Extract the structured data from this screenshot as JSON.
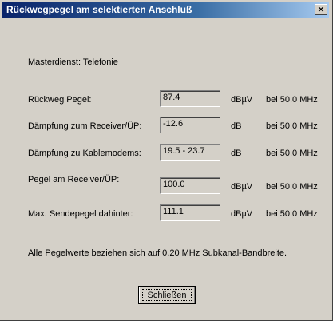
{
  "window": {
    "title": "Rückwegpegel am selektierten Anschluß",
    "close_glyph": "×"
  },
  "master_service": "Masterdienst: Telefonie",
  "rows": [
    {
      "label": "Rückweg Pegel:",
      "value": "87.4",
      "unit": "dBµV",
      "freq": "bei 50.0 MHz"
    },
    {
      "label": "Dämpfung zum Receiver/ÜP:",
      "value": "-12.6",
      "unit": "dB",
      "freq": "bei 50.0 MHz"
    },
    {
      "label": "Dämpfung zu Kablemodems:",
      "value": "19.5 - 23.7",
      "unit": "dB",
      "freq": "bei 50.0 MHz"
    },
    {
      "label": "Pegel am Receiver/ÜP:",
      "value": "100.0",
      "unit": "dBµV",
      "freq": "bei 50.0 MHz"
    },
    {
      "label": "Max. Sendepegel dahinter:",
      "value": "111.1",
      "unit": "dBµV",
      "freq": "bei 50.0 MHz"
    }
  ],
  "footnote": "Alle Pegelwerte beziehen sich auf 0.20 MHz Subkanal-Bandbreite.",
  "close_button_label": "Schließen"
}
